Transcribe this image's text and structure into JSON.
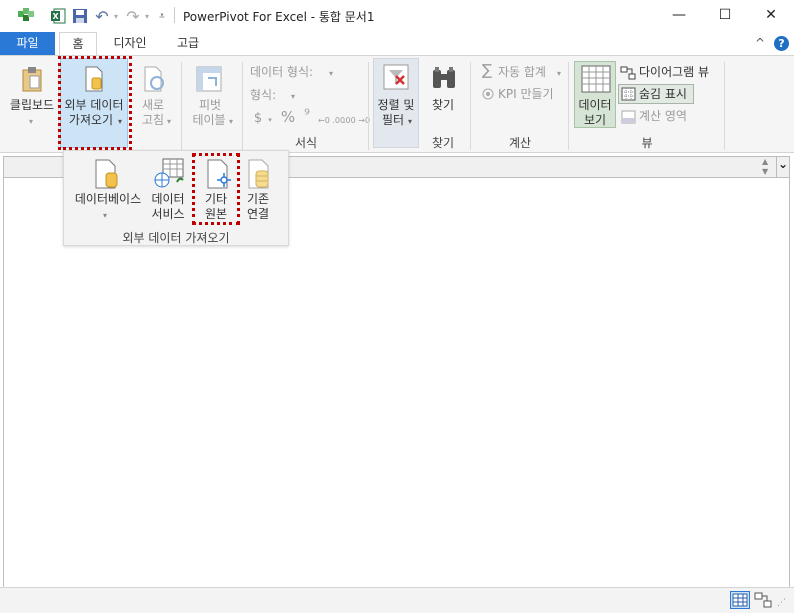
{
  "window": {
    "title": "PowerPivot For Excel - 통합 문서1",
    "controls": {
      "minimize": "—",
      "maximize": "☐",
      "close": "✕"
    }
  },
  "quick_access": {
    "icons": [
      "powerpivot-icon",
      "excel-icon",
      "save-icon",
      "undo-icon",
      "redo-icon",
      "customize-icon"
    ]
  },
  "tabs": [
    {
      "label": "파일"
    },
    {
      "label": "홈"
    },
    {
      "label": "디자인"
    },
    {
      "label": "고급"
    }
  ],
  "ribbon": {
    "clipboard": {
      "label": "클립보드"
    },
    "external_data": {
      "label_line1": "외부 데이터",
      "label_line2": "가져오기"
    },
    "refresh": {
      "label_line1": "새로",
      "label_line2": "고침"
    },
    "pivot_table": {
      "label_line1": "피벗",
      "label_line2": "테이블"
    },
    "formatting": {
      "data_format": "데이터 형식:",
      "format": "형식:",
      "currency": "$",
      "percent": "%",
      "comma": "⁹",
      "inc_decimal": "←0 .00",
      "dec_decimal": ".00 →0",
      "group_label": "서식"
    },
    "sort_filter": {
      "label_line1": "정렬 및",
      "label_line2": "필터",
      "group_label": ""
    },
    "find": {
      "label": "찾기",
      "group_label": "찾기"
    },
    "calc": {
      "autosum": "자동 합계",
      "kpi": "KPI 만들기",
      "group_label": "계산"
    },
    "view": {
      "data_view_line1": "데이터",
      "data_view_line2": "보기",
      "diagram_view": "다이어그램 뷰",
      "show_hidden": "숨김 표시",
      "calc_area": "계산 영역",
      "group_label": "뷰"
    },
    "collapse": "^",
    "help": "?"
  },
  "dropdown": {
    "database": "데이터베이스",
    "data_service_line1": "데이터",
    "data_service_line2": "서비스",
    "other_source_line1": "기타",
    "other_source_line2": "원본",
    "existing_line1": "기존",
    "existing_line2": "연결",
    "group_label": "외부 데이터 가져오기"
  },
  "formula_bar": {
    "scroll_up": "▲",
    "scroll_down": "▼",
    "expand": "⌄"
  },
  "colors": {
    "accent": "#2b79d6",
    "highlight": "#cde4f7",
    "annotation": "#c00000",
    "excel_green": "#217346"
  }
}
